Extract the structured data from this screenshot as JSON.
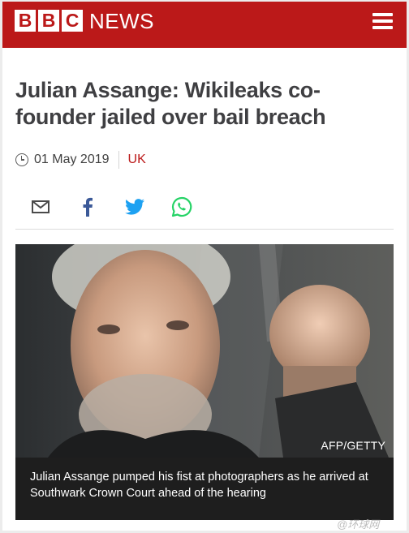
{
  "header": {
    "logo_letters": [
      "B",
      "B",
      "C"
    ],
    "logo_word": "NEWS",
    "menu_icon": "hamburger-menu-icon",
    "brand_color": "#bb1919"
  },
  "article": {
    "headline": "Julian Assange: Wikileaks co-founder jailed over bail breach",
    "date": "01 May 2019",
    "section": "UK"
  },
  "share": {
    "icons": [
      "email-icon",
      "facebook-icon",
      "twitter-icon",
      "whatsapp-icon"
    ],
    "colors": {
      "email": "#4a4a4a",
      "facebook": "#3b5998",
      "twitter": "#1da1f2",
      "whatsapp": "#25d366"
    }
  },
  "media": {
    "credit": "AFP/GETTY",
    "caption": "Julian Assange pumped his fist at photographers as he arrived at Southwark Crown Court ahead of the hearing"
  },
  "watermark": "@环球网"
}
